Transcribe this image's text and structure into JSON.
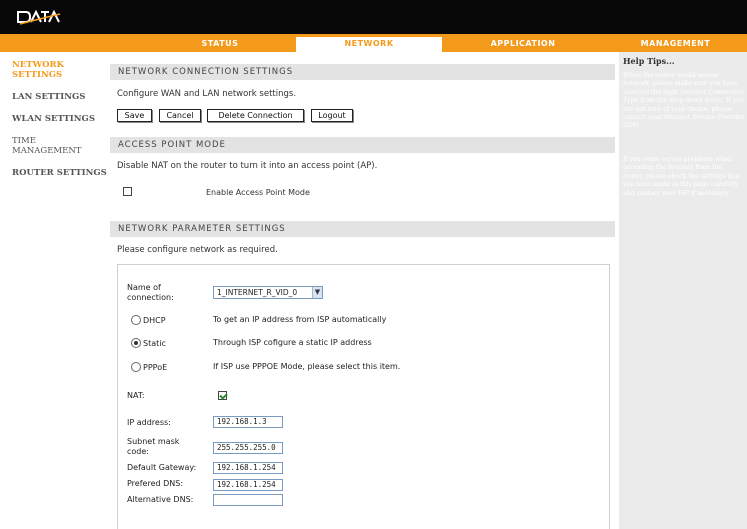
{
  "logo": {
    "text": "DATA"
  },
  "nav": {
    "tabs": [
      {
        "label": "STATUS",
        "active": false
      },
      {
        "label": "NETWORK",
        "active": true
      },
      {
        "label": "APPLICATION",
        "active": false
      },
      {
        "label": "MANAGEMENT",
        "active": false
      }
    ]
  },
  "sidebar": {
    "items": [
      {
        "label": "NETWORK SETTINGS",
        "active": true
      },
      {
        "label": "LAN SETTINGS",
        "active": false
      },
      {
        "label": "WLAN SETTINGS",
        "active": false
      },
      {
        "label": "TIME MANAGEMENT",
        "active": false
      },
      {
        "label": "ROUTER SETTINGS",
        "active": false
      }
    ]
  },
  "help": {
    "title": "Help Tips...",
    "paragraph1": "When the router would access network, please make sure you have selected the right Internet Connection Type from the drop-down menu. If you are not sure of your choice, please contact your Internet Service Provider (ISP)",
    "paragraph2": "If you come across problems when accessing the Internet from the router, please check the settings that you have made in this page carefully, and contact your ISP if necessary."
  },
  "connection": {
    "heading": "NETWORK CONNECTION SETTINGS",
    "description": "Configure WAN and LAN network settings.",
    "buttons": {
      "save": "Save",
      "cancel": "Cancel",
      "delete": "Delete Connection",
      "logout": "Logout"
    }
  },
  "ap_mode": {
    "heading": "ACCESS POINT MODE",
    "description": "Disable NAT on the router to turn it into an access point (AP).",
    "checkbox_label": "Enable Access Point Mode",
    "checked": false
  },
  "parameters": {
    "heading": "NETWORK PARAMETER SETTINGS",
    "description": "Please configure network as required.",
    "name_label": "Name of connection:",
    "name_value": "1_INTERNET_R_VID_0",
    "modes": [
      {
        "label": "DHCP",
        "desc": "To get an IP address from ISP automatically",
        "selected": false
      },
      {
        "label": "Static",
        "desc": "Through ISP cofigure a static IP address",
        "selected": true
      },
      {
        "label": "PPPoE",
        "desc": "If ISP use PPPOE Mode, please select this item.",
        "selected": false
      }
    ],
    "nat_label": "NAT:",
    "nat_checked": true,
    "fields": {
      "ip_label": "IP address:",
      "ip_value": "192.168.1.3",
      "mask_label": "Subnet mask code:",
      "mask_value": "255.255.255.0",
      "gateway_label": "Default Gateway:",
      "gateway_value": "192.168.1.254",
      "dns_label": "Prefered DNS:",
      "dns_value": "192.168.1.254",
      "alt_dns_label": "Alternative DNS:",
      "alt_dns_value": ""
    }
  },
  "colors": {
    "accent": "#f39a1b",
    "topbar": "#080808",
    "section_bg": "#e3e3e3",
    "help_bg": "#ebebeb"
  }
}
